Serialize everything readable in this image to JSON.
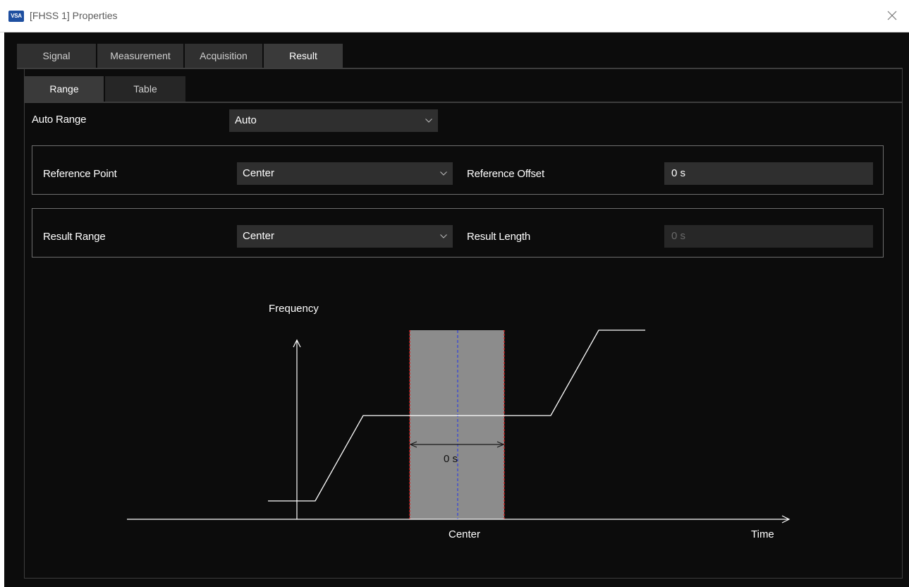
{
  "window": {
    "app_badge": "VSA",
    "title": "[FHSS 1] Properties"
  },
  "main_tabs": [
    {
      "label": "Signal",
      "active": false
    },
    {
      "label": "Measurement",
      "active": false
    },
    {
      "label": "Acquisition",
      "active": false
    },
    {
      "label": "Result",
      "active": true
    }
  ],
  "sub_tabs": [
    {
      "label": "Range",
      "active": true
    },
    {
      "label": "Table",
      "active": false
    }
  ],
  "auto_range": {
    "label": "Auto Range",
    "value": "Auto"
  },
  "reference_group": {
    "point_label": "Reference Point",
    "point_value": "Center",
    "offset_label": "Reference Offset",
    "offset_value": "0 s"
  },
  "result_group": {
    "range_label": "Result Range",
    "range_value": "Center",
    "length_label": "Result Length",
    "length_value": "0 s",
    "length_disabled": true
  },
  "diagram": {
    "y_axis_label": "Frequency",
    "x_axis_label": "Time",
    "center_label": "Center",
    "span_label": "0 s"
  },
  "colors": {
    "background": "#0c0c0c",
    "control_bg": "#2f2f2f",
    "window_bar": "#ffffff",
    "badge_blue": "#1e4fa0",
    "range_fill": "#8c8c8c",
    "range_edge": "#e01818",
    "center_line": "#2f3fe0"
  }
}
